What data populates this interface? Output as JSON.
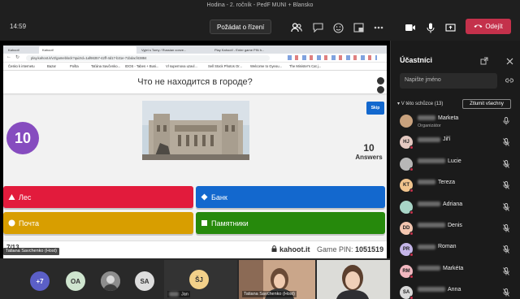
{
  "window": {
    "title": "Hodina - 2. ročník - PedF MUNI + Blansko",
    "time": "14:59"
  },
  "toolbar": {
    "request_control": "Požádat o řízení",
    "leave": "Odejít"
  },
  "browser": {
    "tabs": [
      "Kahoot!",
      "Kahoot!",
      "Vyjet s Tomy / Russian conve...",
      "Play Kahoot! - Enter game PIN h..."
    ],
    "url": "play.kahoot.it/v2/gameblock?quizId=1af66357-42ff-4d17-b31e-71bdacf43884",
    "bookmarks": [
      "Česko k internetu",
      "Bazar",
      "Pošta",
      "Taťána Savčenko...",
      "IDOS - Tabes + Busi...",
      "Vl supernova uzavl...",
      "Sell Stock Photos Or...",
      "Welcome to Gyeou...",
      "The Minister's Cat j..."
    ]
  },
  "kahoot": {
    "question": "Что не находится в городе?",
    "timer": "10",
    "skip": "Skip",
    "answers_count": "10",
    "answers_label": "Answers",
    "answers": [
      {
        "text": "Лес",
        "symbol": "triangle",
        "color": "#e21b3c"
      },
      {
        "text": "Банк",
        "symbol": "diamond",
        "color": "#1368ce"
      },
      {
        "text": "Почта",
        "symbol": "circle",
        "color": "#d89e00"
      },
      {
        "text": "Памятники",
        "symbol": "square",
        "color": "#26890c"
      }
    ],
    "counter": "7/13",
    "brand": "kahoot.it",
    "pin_label": "Game PIN:",
    "pin": "1051519"
  },
  "share_name": "Tatiana Savchenko (Host)",
  "strip": {
    "more": "+7",
    "avatars": [
      "OA",
      "SA",
      "ŠJ"
    ],
    "tile_names": [
      "Jan",
      "Tatiana Savchenko (Host)"
    ]
  },
  "panel": {
    "title": "Účastníci",
    "search_placeholder": "Napište jméno",
    "section": "V této schůzce (13)",
    "mute_all": "Ztlumit všechny",
    "people": [
      {
        "initials": "",
        "name": "Marketa",
        "role": "Organizátor",
        "color": "#c9a27e"
      },
      {
        "initials": "HJ",
        "name": "Jiří",
        "role": "",
        "color": "#e4c9c1"
      },
      {
        "initials": "",
        "name": "Lucie",
        "role": "",
        "color": "#b7b7b7"
      },
      {
        "initials": "KT",
        "name": "Tereza",
        "role": "",
        "color": "#f1c48d"
      },
      {
        "initials": "",
        "name": "Adriana",
        "role": "",
        "color": "#a8d5c7"
      },
      {
        "initials": "DD",
        "name": "Denis",
        "role": "",
        "color": "#f3c6b0"
      },
      {
        "initials": "PR",
        "name": "Roman",
        "role": "",
        "color": "#c4b5e8"
      },
      {
        "initials": "RM",
        "name": "Markéta",
        "role": "",
        "color": "#f2b8c0"
      },
      {
        "initials": "SA",
        "name": "Anna",
        "role": "",
        "color": "#d8d8d8"
      }
    ]
  }
}
